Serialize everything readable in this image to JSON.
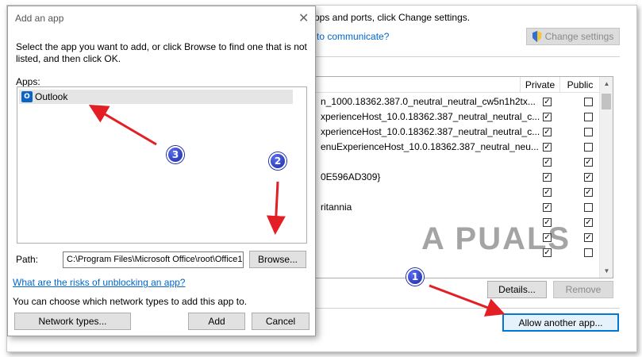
{
  "background_window": {
    "header_line": "pps and ports, click Change settings.",
    "link_text": "to communicate?",
    "change_settings_label": "Change settings",
    "columns": {
      "private": "Private",
      "public": "Public"
    },
    "rows": [
      {
        "name": "n_1000.18362.387.0_neutral_neutral_cw5n1h2tx...",
        "private": true,
        "public": false
      },
      {
        "name": "xperienceHost_10.0.18362.387_neutral_neutral_c...",
        "private": true,
        "public": false
      },
      {
        "name": "xperienceHost_10.0.18362.387_neutral_neutral_c...",
        "private": true,
        "public": false
      },
      {
        "name": "enuExperienceHost_10.0.18362.387_neutral_neu...",
        "private": true,
        "public": false
      },
      {
        "name": "",
        "private": true,
        "public": true
      },
      {
        "name": "0E596AD309}",
        "private": true,
        "public": true
      },
      {
        "name": "",
        "private": true,
        "public": true
      },
      {
        "name": "ritannia",
        "private": true,
        "public": false
      },
      {
        "name": "",
        "private": true,
        "public": true
      },
      {
        "name": "",
        "private": true,
        "public": true
      },
      {
        "name": "",
        "private": true,
        "public": false
      }
    ],
    "details_label": "Details...",
    "remove_label": "Remove",
    "allow_another_label": "Allow another app..."
  },
  "dialog": {
    "title": "Add an app",
    "close_glyph": "✕",
    "instruction_line1": "Select the app you want to add, or click Browse to find one that is not",
    "instruction_line2": "listed, and then click OK.",
    "apps_label": "Apps:",
    "apps": [
      {
        "label": "Outlook",
        "icon": "outlook-icon"
      }
    ],
    "path_label": "Path:",
    "path_value": "C:\\Program Files\\Microsoft Office\\root\\Office1",
    "browse_label": "Browse...",
    "risk_link": "What are the risks of unblocking an app?",
    "network_info": "You can choose which network types to add this app to.",
    "network_types_label": "Network types...",
    "add_label": "Add",
    "cancel_label": "Cancel"
  },
  "annotations": {
    "badges": [
      "1",
      "2",
      "3"
    ],
    "watermark": "A PUALS",
    "arrow_color": "#e31e24",
    "badge_color": "#2233bb"
  }
}
